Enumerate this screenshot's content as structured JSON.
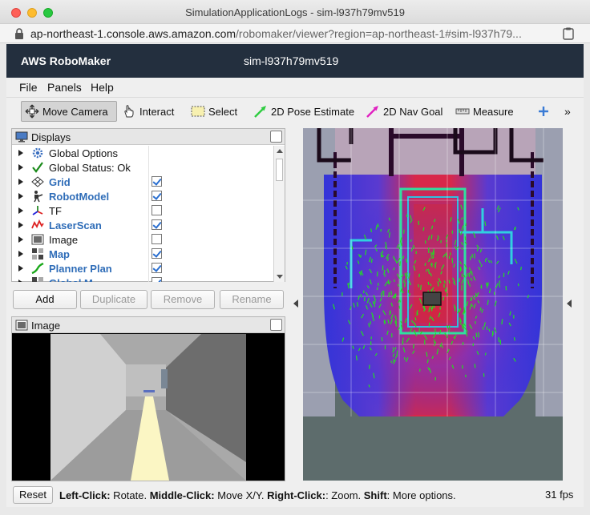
{
  "window": {
    "title": "SimulationApplicationLogs - sim-l937h79mv519"
  },
  "browser": {
    "url_host": "ap-northeast-1.console.aws.amazon.com",
    "url_path": "/robomaker/viewer?region=ap-northeast-1#sim-l937h79..."
  },
  "aws_header": {
    "brand": "AWS RoboMaker",
    "simulation": "sim-l937h79mv519"
  },
  "menu": {
    "file": "File",
    "panels": "Panels",
    "help": "Help"
  },
  "toolbar": {
    "move_camera": "Move Camera",
    "interact": "Interact",
    "select": "Select",
    "pose_estimate": "2D Pose Estimate",
    "nav_goal": "2D Nav Goal",
    "measure": "Measure",
    "overflow": "»"
  },
  "displays": {
    "title": "Displays",
    "items": [
      {
        "label": "Global Options",
        "icon": "gear-icon",
        "checked": null,
        "bold": false
      },
      {
        "label": "Global Status: Ok",
        "icon": "checkmark-icon",
        "checked": null,
        "bold": false
      },
      {
        "label": "Grid",
        "icon": "grid-icon",
        "checked": true,
        "bold": true
      },
      {
        "label": "RobotModel",
        "icon": "robot-icon",
        "checked": true,
        "bold": true
      },
      {
        "label": "TF",
        "icon": "axes-icon",
        "checked": false,
        "bold": false
      },
      {
        "label": "LaserScan",
        "icon": "laserscan-icon",
        "checked": true,
        "bold": true
      },
      {
        "label": "Image",
        "icon": "image-icon",
        "checked": false,
        "bold": false
      },
      {
        "label": "Map",
        "icon": "map-icon",
        "checked": true,
        "bold": true
      },
      {
        "label": "Planner Plan",
        "icon": "path-icon",
        "checked": true,
        "bold": true
      },
      {
        "label": "Global M...",
        "icon": "map-icon",
        "checked": true,
        "bold": true
      }
    ],
    "buttons": {
      "add": "Add",
      "duplicate": "Duplicate",
      "remove": "Remove",
      "rename": "Rename"
    }
  },
  "image_panel": {
    "title": "Image"
  },
  "status": {
    "reset": "Reset",
    "left_click_key": "Left-Click:",
    "left_click_val": " Rotate. ",
    "middle_click_key": "Middle-Click:",
    "middle_click_val": " Move X/Y. ",
    "right_click_key": "Right-Click:",
    "right_click_val": ": Zoom. ",
    "shift_key": "Shift",
    "shift_val": ": More options.",
    "fps": "31 fps"
  },
  "colors": {
    "aws_header": "#232f3e",
    "link_blue": "#2f6db8",
    "costmap_blue": "#3a3ae0",
    "costmap_red": "#e0203a",
    "particle_green": "#22dd22"
  }
}
